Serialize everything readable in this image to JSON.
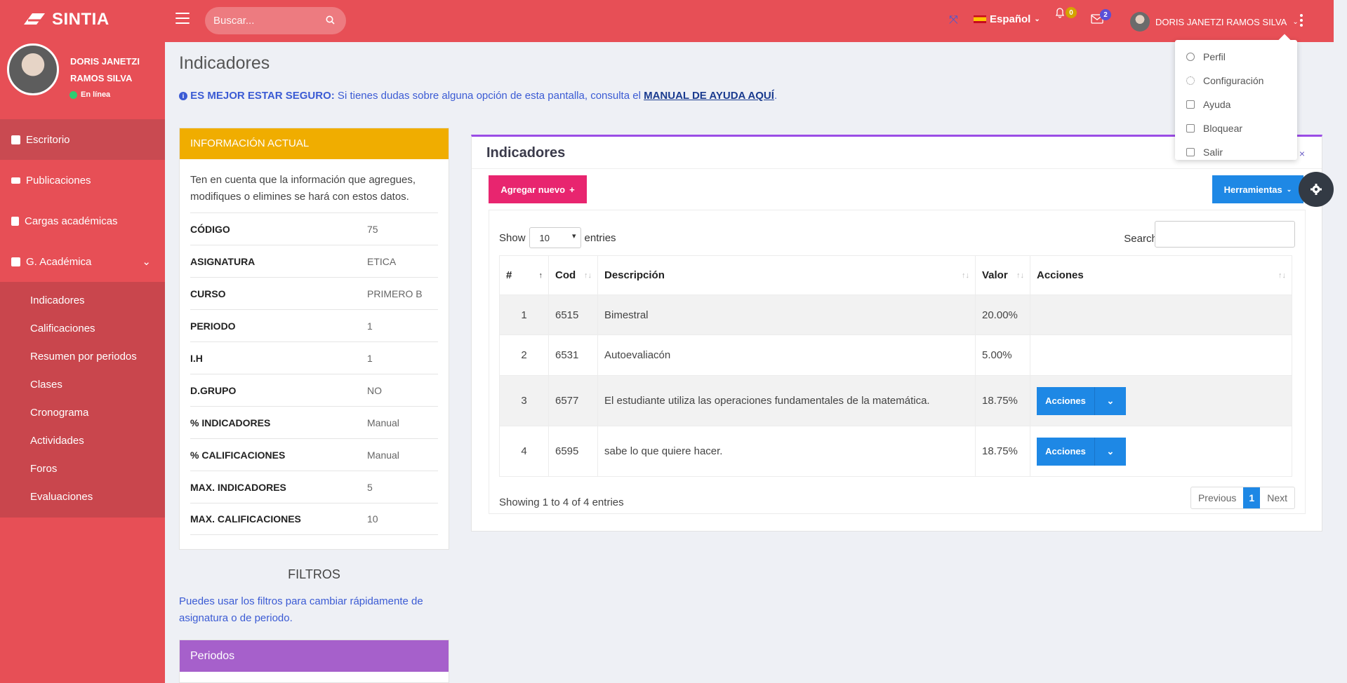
{
  "header": {
    "brand": "SINTIA",
    "search_placeholder": "Buscar...",
    "language": "Español",
    "notif_count": "0",
    "mail_count": "2",
    "user_name": "DORIS JANETZI RAMOS SILVA"
  },
  "sidebar": {
    "profile_name": "DORIS JANETZI RAMOS SILVA",
    "status": "En línea",
    "items": [
      {
        "label": "Escritorio",
        "icon": "dashboard-icon"
      },
      {
        "label": "Publicaciones",
        "icon": "columns-icon"
      },
      {
        "label": "Cargas académicas",
        "icon": "book-icon"
      },
      {
        "label": "G. Académica",
        "icon": "id-card-icon"
      }
    ],
    "submenu": [
      "Indicadores",
      "Calificaciones",
      "Resumen por periodos",
      "Clases",
      "Cronograma",
      "Actividades",
      "Foros",
      "Evaluaciones"
    ]
  },
  "page": {
    "title": "Indicadores",
    "notice_bold": "ES MEJOR ESTAR SEGURO:",
    "notice_text": " Si tienes dudas sobre alguna opción de esta pantalla, consulta el ",
    "notice_link": "MANUAL DE AYUDA AQUÍ",
    "notice_end": "."
  },
  "info": {
    "title": "INFORMACIÓN ACTUAL",
    "desc": "Ten en cuenta que la información que agregues, modifiques o elimines se hará con estos datos.",
    "rows": [
      {
        "k": "CÓDIGO",
        "v": "75"
      },
      {
        "k": "ASIGNATURA",
        "v": "ETICA"
      },
      {
        "k": "CURSO",
        "v": "PRIMERO B"
      },
      {
        "k": "PERIODO",
        "v": "1"
      },
      {
        "k": "I.H",
        "v": "1"
      },
      {
        "k": "D.GRUPO",
        "v": "NO"
      },
      {
        "k": "% INDICADORES",
        "v": "Manual"
      },
      {
        "k": "% CALIFICACIONES",
        "v": "Manual"
      },
      {
        "k": "MAX. INDICADORES",
        "v": "5"
      },
      {
        "k": "MAX. CALIFICACIONES",
        "v": "10"
      }
    ]
  },
  "filters": {
    "title": "FILTROS",
    "desc": "Puedes usar los filtros para cambiar rápidamente de asignatura o de periodo.",
    "periods_title": "Periodos"
  },
  "indicators": {
    "title": "Indicadores",
    "close": "×",
    "add_button": "Agregar nuevo",
    "tools_button": "Herramientas",
    "show_label": "Show",
    "show_value": "10",
    "entries_label": "entries",
    "search_label": "Search:",
    "columns": [
      "#",
      "Cod",
      "Descripción",
      "Valor",
      "Acciones"
    ],
    "rows": [
      {
        "n": "1",
        "cod": "6515",
        "desc": "Bimestral",
        "valor": "20.00%",
        "action": ""
      },
      {
        "n": "2",
        "cod": "6531",
        "desc": "Autoevaliacón",
        "valor": "5.00%",
        "action": ""
      },
      {
        "n": "3",
        "cod": "6577",
        "desc": "El estudiante utiliza las operaciones fundamentales de la matemática.",
        "valor": "18.75%",
        "action": "Acciones"
      },
      {
        "n": "4",
        "cod": "6595",
        "desc": "sabe lo que quiere hacer.",
        "valor": "18.75%",
        "action": "Acciones"
      }
    ],
    "showing": "Showing 1 to 4 of 4 entries",
    "pager": {
      "prev": "Previous",
      "current": "1",
      "next": "Next"
    }
  },
  "user_menu": [
    {
      "label": "Perfil",
      "icon": "user-icon"
    },
    {
      "label": "Configuración",
      "icon": "settings-icon"
    },
    {
      "label": "Ayuda",
      "icon": "help-icon"
    },
    {
      "label": "Bloquear",
      "icon": "lock-icon"
    },
    {
      "label": "Salir",
      "icon": "logout-icon"
    }
  ],
  "colors": {
    "primary": "#e74f56",
    "warning": "#f0ad00",
    "purple": "#a660cb",
    "accent_pink": "#e8256f",
    "blue": "#1e88e5"
  }
}
